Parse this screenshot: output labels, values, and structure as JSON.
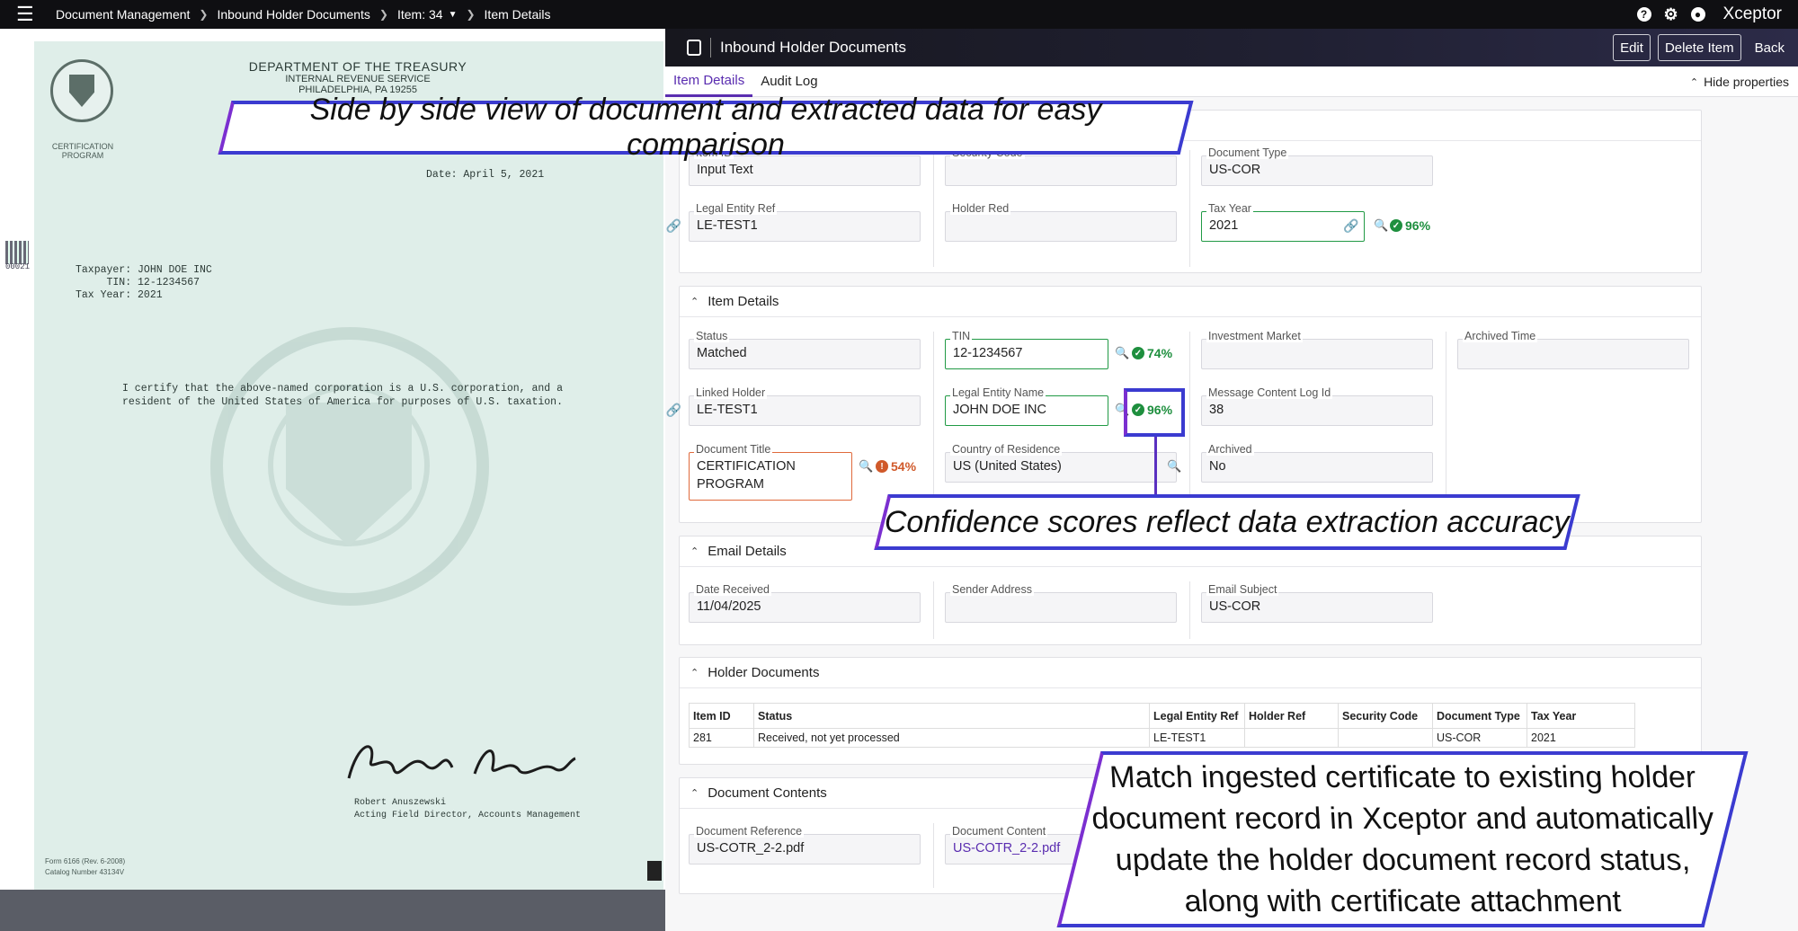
{
  "nav": {
    "breadcrumb": [
      "Document Management",
      "Inbound Holder Documents",
      "Item: 34",
      "Item Details"
    ],
    "brand": "Xceptor",
    "icons": [
      "help-icon",
      "settings-icon",
      "user-icon"
    ]
  },
  "document": {
    "dept": "DEPARTMENT OF THE TREASURY",
    "service": "INTERNAL REVENUE SERVICE",
    "city": "PHILADELPHIA, PA 19255",
    "cert_label": "CERTIFICATION PROGRAM",
    "date": "Date: April 5, 2021",
    "taxpayer": "Taxpayer: JOHN DOE INC",
    "tin": "     TIN: 12-1234567",
    "tax_year": "Tax Year: 2021",
    "side_id": "00021",
    "certify_1": "I certify that the above-named corporation is a U.S. corporation, and a",
    "certify_2": "resident of the United States of America for purposes of U.S. taxation.",
    "signer": "Robert Anuszewski",
    "signer_title": "Acting Field Director, Accounts Management",
    "form": "Form 6166 (Rev. 6-2008)",
    "catalog": "Catalog Number 43134V"
  },
  "app": {
    "title": "Inbound Holder Documents",
    "buttons": {
      "edit": "Edit",
      "delete": "Delete Item",
      "back": "Back"
    },
    "tabs": [
      "Item Details",
      "Audit Log"
    ],
    "hide_properties": "Hide properties"
  },
  "top_fields": {
    "item_id": {
      "label": "Item ID",
      "value": "Input Text"
    },
    "security_code": {
      "label": "Security Code",
      "value": ""
    },
    "document_type": {
      "label": "Document Type",
      "value": "US-COR"
    },
    "legal_entity_ref": {
      "label": "Legal Entity Ref",
      "value": "LE-TEST1"
    },
    "holder_red": {
      "label": "Holder Red",
      "value": ""
    },
    "tax_year": {
      "label": "Tax Year",
      "value": "2021",
      "confidence": "96%"
    }
  },
  "item_details": {
    "title": "Item Details",
    "status": {
      "label": "Status",
      "value": "Matched"
    },
    "tin": {
      "label": "TIN",
      "value": "12-1234567",
      "confidence": "74%"
    },
    "investment_market": {
      "label": "Investment Market",
      "value": ""
    },
    "archived_time": {
      "label": "Archived Time",
      "value": ""
    },
    "linked_holder": {
      "label": "Linked Holder",
      "value": "LE-TEST1"
    },
    "legal_entity_name": {
      "label": "Legal Entity Name",
      "value": "JOHN DOE INC",
      "confidence": "96%"
    },
    "message_log": {
      "label": "Message Content Log Id",
      "value": "38"
    },
    "document_title": {
      "label": "Document Title",
      "value_1": "CERTIFICATION",
      "value_2": "PROGRAM",
      "confidence": "54%"
    },
    "country": {
      "label": "Country of Residence",
      "value": "US (United States)"
    },
    "archived": {
      "label": "Archived",
      "value": "No"
    }
  },
  "email_details": {
    "title": "Email Details",
    "date_received": {
      "label": "Date Received",
      "value": "11/04/2025"
    },
    "sender": {
      "label": "Sender Address",
      "value": ""
    },
    "subject": {
      "label": "Email Subject",
      "value": "US-COR"
    }
  },
  "holder_documents": {
    "title": "Holder Documents",
    "columns": [
      "Item ID",
      "Status",
      "Legal Entity Ref",
      "Holder Ref",
      "Security Code",
      "Document Type",
      "Tax Year"
    ],
    "rows": [
      [
        "281",
        "Received, not yet processed",
        "LE-TEST1",
        "",
        "",
        "US-COR",
        "2021"
      ]
    ]
  },
  "document_contents": {
    "title": "Document Contents",
    "reference": {
      "label": "Document Reference",
      "value": "US-COTR_2-2.pdf"
    },
    "content": {
      "label": "Document Content",
      "value": "US-COTR_2-2.pdf"
    }
  },
  "callouts": {
    "side_by_side": "Side by side view of document and extracted data for easy comparison",
    "confidence": "Confidence scores reflect data extraction accuracy",
    "match_1": "Match ingested certificate to existing holder",
    "match_2": "document record in Xceptor and automatically",
    "match_3": "update the holder document record status,",
    "match_4": "along with certificate attachment"
  },
  "colors": {
    "accent": "#5a2db0",
    "success": "#1e8f3e",
    "warning": "#d0592a",
    "callout_border": "#3b3bd0"
  }
}
